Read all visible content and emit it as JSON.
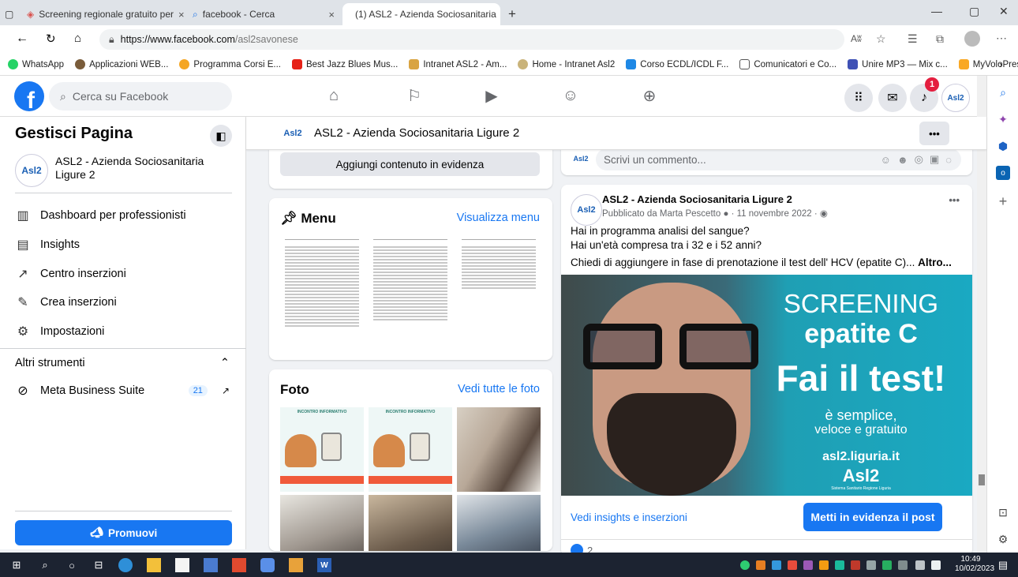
{
  "browser": {
    "tabs": [
      {
        "title": "Screening regionale gratuito per",
        "active": false
      },
      {
        "title": "facebook - Cerca",
        "active": false
      },
      {
        "title": "(1) ASL2 - Azienda Sociosanitaria",
        "active": true
      }
    ],
    "new_tab": "+",
    "url_host": "https://www.facebook.com",
    "url_path": "/asl2savonese",
    "reader_mode": "Aʬ",
    "bookmarks": [
      {
        "label": "WhatsApp",
        "color": "#25d366"
      },
      {
        "label": "Applicazioni WEB...",
        "color": "#7a5c3a"
      },
      {
        "label": "Programma Corsi E...",
        "color": "#f5a623"
      },
      {
        "label": "Best Jazz Blues Mus...",
        "color": "#e62117"
      },
      {
        "label": "Intranet ASL2 - Am...",
        "color": "#d9a441"
      },
      {
        "label": "Home - Intranet Asl2",
        "color": "#c9b37a"
      },
      {
        "label": "Corso ECDL/ICDL F...",
        "color": "#1e88e5"
      },
      {
        "label": "Comunicatori e Co...",
        "color": "#ffffff"
      },
      {
        "label": "Unire MP3 — Mix c...",
        "color": "#3f51b5"
      },
      {
        "label": "MyVoloPress",
        "color": "#f9a825"
      }
    ]
  },
  "fb_header": {
    "logo": "f",
    "search_placeholder": "Cerca su Facebook",
    "notification_count": "1",
    "profile_logo": "Asl2"
  },
  "sidebar": {
    "title": "Gestisci Pagina",
    "page_name": "ASL2 - Azienda Sociosanitaria Ligure 2",
    "page_logo": "Asl2",
    "items": [
      {
        "label": "Dashboard per professionisti",
        "icon": "dashboard-icon",
        "glyph": "▥"
      },
      {
        "label": "Insights",
        "icon": "insights-icon",
        "glyph": "▤"
      },
      {
        "label": "Centro inserzioni",
        "icon": "megaphone-icon",
        "glyph": "↗"
      },
      {
        "label": "Crea inserzioni",
        "icon": "edit-icon",
        "glyph": "✎"
      },
      {
        "label": "Impostazioni",
        "icon": "gear-icon",
        "glyph": "⚙"
      }
    ],
    "other_tools": "Altri strumenti",
    "meta_suite": "Meta Business Suite",
    "meta_count": "21",
    "promote_label": "Promuovi"
  },
  "page_bar": {
    "logo": "Asl2",
    "title": "ASL2 - Azienda Sociosanitaria Ligure 2",
    "more": "•••"
  },
  "cards": {
    "evid_button": "Aggiungi contenuto in evidenza",
    "menu_title": "Menu",
    "menu_link": "Visualizza menu",
    "photos_title": "Foto",
    "photos_link": "Vedi tutte le foto"
  },
  "comment": {
    "logo": "Asl2",
    "placeholder": "Scrivi un commento..."
  },
  "post": {
    "logo": "Asl2",
    "author": "ASL2 - Azienda Sociosanitaria Ligure 2",
    "meta": "Pubblicato da Marta Pescetto",
    "date": "11 novembre 2022",
    "line1": "Hai in programma analisi del sangue?",
    "line2": "Hai un'età compresa tra i 32 e i 52 anni?",
    "line3": "Chiedi di aggiungere in fase di prenotazione il test dell' HCV (epatite C)...",
    "more": "Altro...",
    "image": {
      "screening": "SCREENING",
      "epatite": "epatite C",
      "test": "Fai il test!",
      "sub1": "è semplice,",
      "sub2": "veloce e gratuito",
      "site": "asl2.liguria.it",
      "brand": "Asl2",
      "brand_sub": "Sistema Sanitario Regione Liguria"
    },
    "insights_link": "Vedi insights e inserzioni",
    "boost_button": "Metti in evidenza il post",
    "likes": "2"
  },
  "taskbar": {
    "time": "10:49",
    "date": "10/02/2023"
  }
}
